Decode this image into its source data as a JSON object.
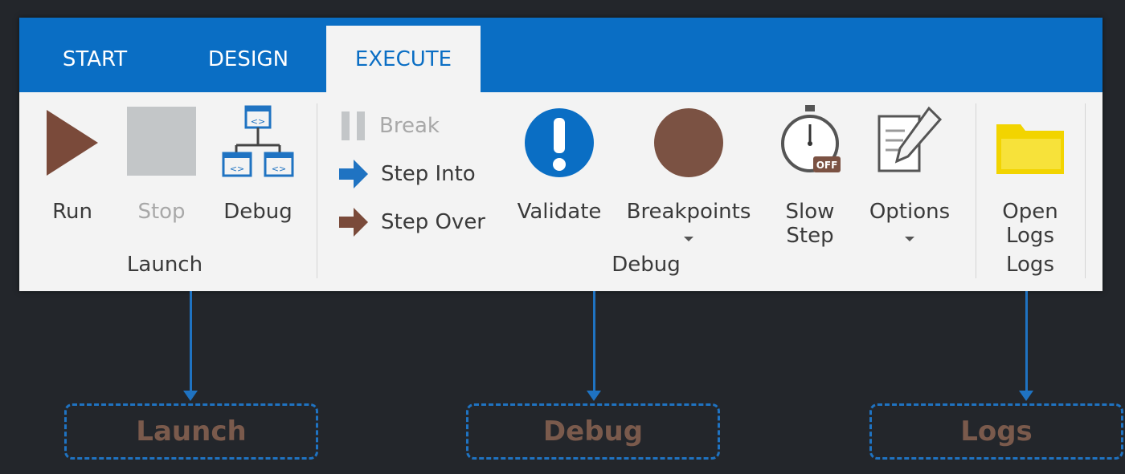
{
  "tabs": [
    {
      "label": "START"
    },
    {
      "label": "DESIGN"
    },
    {
      "label": "EXECUTE"
    }
  ],
  "active_tab": "EXECUTE",
  "groups": {
    "launch": {
      "label": "Launch",
      "run": {
        "label": "Run",
        "icon": "play-icon"
      },
      "stop": {
        "label": "Stop",
        "icon": "stop-icon",
        "enabled": false
      },
      "debug": {
        "label": "Debug",
        "icon": "debug-flow-icon"
      }
    },
    "debug": {
      "label": "Debug",
      "break": {
        "label": "Break",
        "icon": "pause-icon",
        "enabled": false
      },
      "step_into": {
        "label": "Step Into",
        "icon": "step-into-arrow-icon"
      },
      "step_over": {
        "label": "Step Over",
        "icon": "step-over-arrow-icon"
      },
      "validate": {
        "label": "Validate",
        "icon": "exclamation-icon"
      },
      "breakpoints": {
        "label": "Breakpoints",
        "icon": "breakpoint-circle-icon"
      },
      "slow_step": {
        "label_line1": "Slow",
        "label_line2": "Step",
        "icon": "stopwatch-off-icon",
        "badge": "OFF"
      },
      "options": {
        "label": "Options",
        "icon": "notepad-pencil-icon"
      }
    },
    "logs": {
      "label": "Logs",
      "open_logs": {
        "label_line1": "Open",
        "label_line2": "Logs",
        "icon": "folder-icon"
      }
    }
  },
  "callouts": {
    "launch": "Launch",
    "debug": "Debug",
    "logs": "Logs"
  },
  "colors": {
    "accent": "#0a6ec4",
    "run_brown": "#7a4a3a",
    "breakpoint_brown": "#7b5243",
    "folder_yellow": "#f2d400",
    "callout_text": "#7a5a4c"
  }
}
